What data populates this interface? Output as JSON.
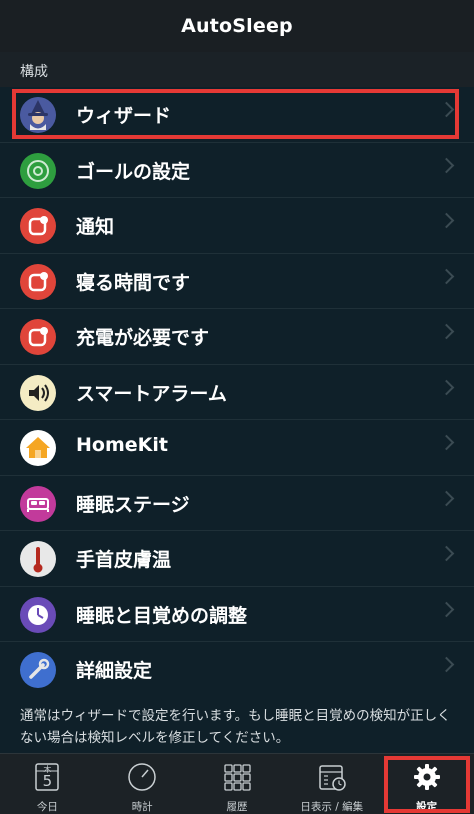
{
  "app": {
    "title": "AutoSleep"
  },
  "section": {
    "header": "構成"
  },
  "rows": [
    {
      "label": "ウィザード",
      "icon": "wizard-icon",
      "color": "#3a4a8c"
    },
    {
      "label": "ゴールの設定",
      "icon": "target-icon",
      "color": "#2e9e3f"
    },
    {
      "label": "通知",
      "icon": "notification-icon",
      "color": "#e0453a"
    },
    {
      "label": "寝る時間です",
      "icon": "bedtime-icon",
      "color": "#e0453a"
    },
    {
      "label": "充電が必要です",
      "icon": "charge-icon",
      "color": "#e0453a"
    },
    {
      "label": "スマートアラーム",
      "icon": "speaker-icon",
      "color": "#f4ecc4"
    },
    {
      "label": "HomeKit",
      "icon": "home-icon",
      "color": "#ffffff"
    },
    {
      "label": "睡眠ステージ",
      "icon": "bed-icon",
      "color": "#c23a9b"
    },
    {
      "label": "手首皮膚温",
      "icon": "thermometer-icon",
      "color": "#e8e8e8"
    },
    {
      "label": "睡眠と目覚めの調整",
      "icon": "clock-icon",
      "color": "#6a4bb8"
    },
    {
      "label": "詳細設定",
      "icon": "wrench-icon",
      "color": "#3f6fcf"
    }
  ],
  "footer": {
    "text": "通常はウィザードで設定を行います。もし睡眠と目覚めの検知が正しくない場合は検知レベルを修正してください。"
  },
  "tabs": [
    {
      "label": "今日",
      "icon": "calendar-icon",
      "weekday": "木",
      "day": "5"
    },
    {
      "label": "時計",
      "icon": "clock-dial-icon"
    },
    {
      "label": "履歴",
      "icon": "grid-icon"
    },
    {
      "label": "日表示 / 編集",
      "icon": "calendar-edit-icon"
    },
    {
      "label": "設定",
      "icon": "gear-icon",
      "active": true
    }
  ],
  "colors": {
    "highlight": "#e53935",
    "accent": "#ffffff",
    "background": "#0f2029"
  }
}
